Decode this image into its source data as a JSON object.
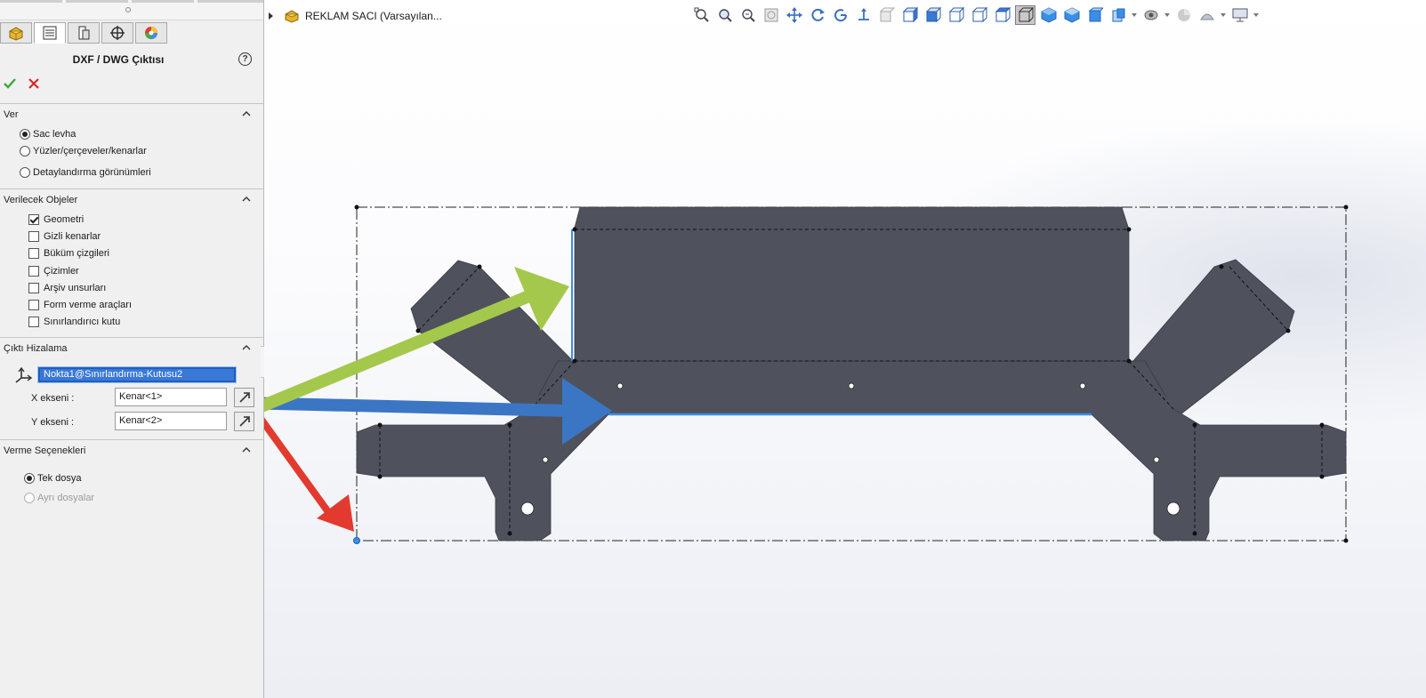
{
  "panel": {
    "title": "DXF / DWG Çıktısı",
    "help_glyph": "?",
    "tabs": [
      "feature-manager",
      "property-manager",
      "configuration-manager",
      "dimxpert-manager",
      "display-manager"
    ],
    "groups": {
      "export": {
        "title": "Ver",
        "options": [
          {
            "label": "Sac levha",
            "selected": true
          },
          {
            "label": "Yüzler/çerçeveler/kenarlar",
            "selected": false
          },
          {
            "label": "Detaylandırma görünümleri",
            "selected": false
          }
        ]
      },
      "entities": {
        "title": "Verilecek Objeler",
        "items": [
          {
            "label": "Geometri",
            "checked": true
          },
          {
            "label": "Gizli kenarlar",
            "checked": false
          },
          {
            "label": "Büküm çizgileri",
            "checked": false
          },
          {
            "label": "Çizimler",
            "checked": false
          },
          {
            "label": "Arşiv unsurları",
            "checked": false
          },
          {
            "label": "Form verme araçları",
            "checked": false
          },
          {
            "label": "Sınırlandırıcı kutu",
            "checked": false
          }
        ]
      },
      "alignment": {
        "title": "Çıktı Hizalama",
        "origin": "Nokta1@Sınırlandırma-Kutusu2",
        "x_axis_label": "X ekseni :",
        "x_axis_value": "Kenar<1>",
        "y_axis_label": "Y ekseni :",
        "y_axis_value": "Kenar<2>"
      },
      "options": {
        "title": "Verme Seçenekleri",
        "items": [
          {
            "label": "Tek dosya",
            "selected": true,
            "enabled": true
          },
          {
            "label": "Ayrı dosyalar",
            "selected": false,
            "enabled": false
          }
        ]
      }
    }
  },
  "viewport": {
    "tree_title": "REKLAM SACI  (Varsayılan...",
    "toolbar_icons": [
      "zoom-to-fit-icon",
      "zoom-to-area-icon",
      "zoom-in-out-icon",
      "zoom-to-selection-icon",
      "pan-icon",
      "rotate-icon",
      "roll-icon",
      "normal-to-icon",
      "front-view-icon",
      "back-view-icon",
      "left-view-icon",
      "right-view-icon",
      "top-view-icon",
      "bottom-view-icon",
      "isometric-view-icon",
      "wireframe-icon",
      "hidden-lines-visible-icon",
      "hidden-lines-removed-icon",
      "shaded-with-edges-icon",
      "shaded-icon",
      "section-view-icon",
      "hide-show-items-icon",
      "edit-appearance-icon",
      "apply-scene-icon",
      "view-settings-icon"
    ],
    "colors": {
      "part_fill": "#4f525d",
      "selection_blue": "#3a8ee6",
      "arrow_green": "#a4c84c",
      "arrow_blue": "#3a76c4",
      "arrow_red": "#e23a2e"
    }
  }
}
